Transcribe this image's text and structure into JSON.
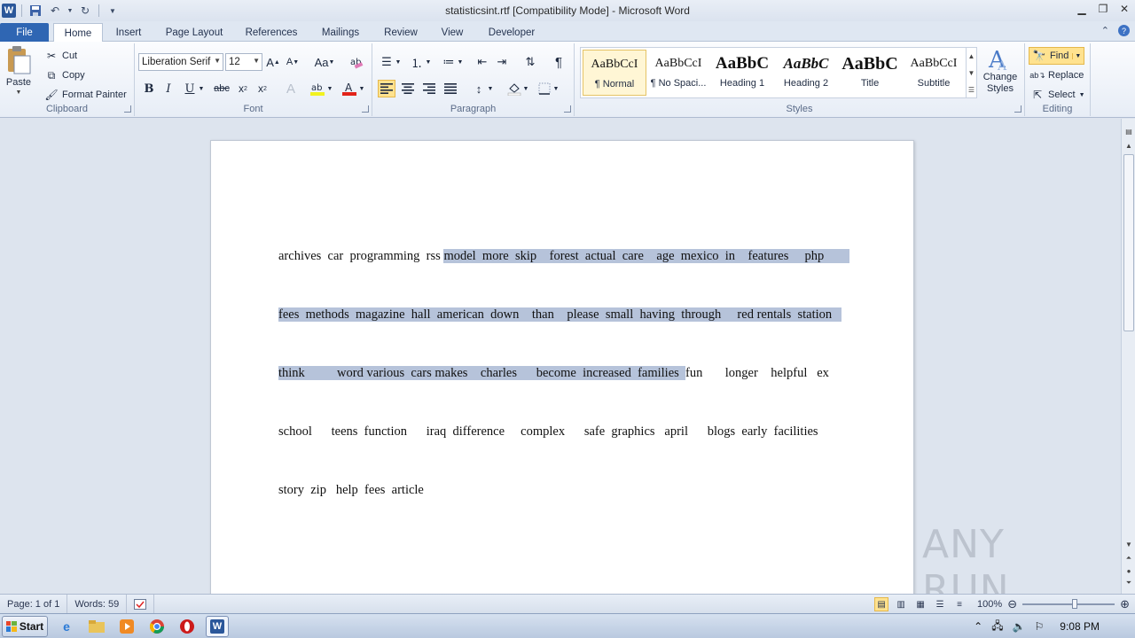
{
  "window": {
    "title": "statisticsint.rtf [Compatibility Mode] - Microsoft Word"
  },
  "tabs": [
    {
      "label": "File"
    },
    {
      "label": "Home"
    },
    {
      "label": "Insert"
    },
    {
      "label": "Page Layout"
    },
    {
      "label": "References"
    },
    {
      "label": "Mailings"
    },
    {
      "label": "Review"
    },
    {
      "label": "View"
    },
    {
      "label": "Developer"
    }
  ],
  "clipboard": {
    "paste": "Paste",
    "cut": "Cut",
    "copy": "Copy",
    "format_painter": "Format Painter",
    "label": "Clipboard"
  },
  "font": {
    "name": "Liberation Serif",
    "size": "12",
    "label": "Font"
  },
  "paragraph": {
    "label": "Paragraph"
  },
  "styles": {
    "items": [
      {
        "preview": "AaBbCcI",
        "name": "¶ Normal"
      },
      {
        "preview": "AaBbCcI",
        "name": "¶ No Spaci..."
      },
      {
        "preview": "AaBbC",
        "name": "Heading 1"
      },
      {
        "preview": "AaBbC",
        "name": "Heading 2"
      },
      {
        "preview": "AaBbC",
        "name": "Title"
      },
      {
        "preview": "AaBbCcI",
        "name": "Subtitle"
      }
    ],
    "change_styles": "Change Styles",
    "label": "Styles"
  },
  "editing": {
    "find": "Find",
    "replace": "Replace",
    "select": "Select",
    "label": "Editing"
  },
  "document": {
    "lines": [
      {
        "plain": "archives  car  programming  rss ",
        "selected": "model  more  skip    forest  actual  care    age  mexico  in    features     php        ",
        "rest": ""
      },
      {
        "plain": "",
        "selected": "fees  methods  magazine  hall  american  down    than    please  small  having  through     red rentals  station   ",
        "rest": ""
      },
      {
        "plain": "",
        "selected": "think          word various  cars makes    charles      become  increased  families  ",
        "rest": "fun       longer    helpful   ex"
      },
      {
        "plain": "school      teens  function      iraq  difference     complex      safe  graphics   april      blogs  early  facilities",
        "selected": "",
        "rest": ""
      },
      {
        "plain": "story  zip   help  fees  article",
        "selected": "",
        "rest": ""
      }
    ]
  },
  "status": {
    "page": "Page: 1 of 1",
    "words": "Words: 59",
    "zoom": "100%"
  },
  "watermark": "ANY RUN",
  "taskbar": {
    "start": "Start",
    "clock": "9:08 PM"
  }
}
